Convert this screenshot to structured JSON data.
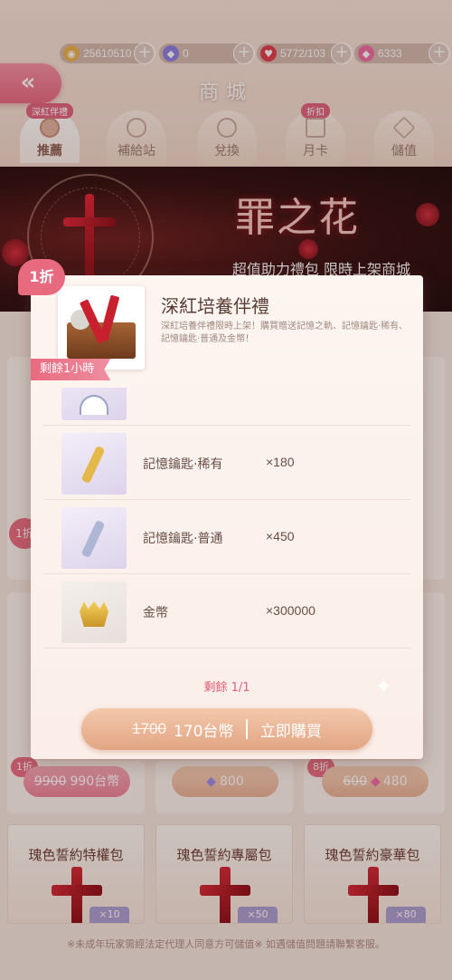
{
  "currencies": [
    {
      "icon": "coin-icon",
      "value": "25610510"
    },
    {
      "icon": "diamond-icon",
      "value": "0"
    },
    {
      "icon": "heart-icon",
      "value": "5772/103"
    },
    {
      "icon": "pink-gem-icon",
      "value": "6333"
    }
  ],
  "header": {
    "title": "商城",
    "back_label": "«"
  },
  "tabs": [
    {
      "label": "推薦",
      "badge": "深紅伴禮",
      "active": true
    },
    {
      "label": "補給站",
      "badge": ""
    },
    {
      "label": "兌換",
      "badge": ""
    },
    {
      "label": "月卡",
      "badge": "折扣"
    },
    {
      "label": "儲值",
      "badge": ""
    }
  ],
  "banner": {
    "title": "罪之花",
    "subtitle": "超值助力禮包 限時上架商城"
  },
  "background": {
    "left_badges": [
      "1折",
      "1折"
    ],
    "row_prices": [
      {
        "old": "9900",
        "new": "990台幣"
      },
      {
        "icon": "diamond-icon",
        "new": "800"
      },
      {
        "old": "600",
        "new": "480",
        "badge": "8折"
      }
    ],
    "badge_left": "1折",
    "packs": [
      {
        "name": "瑰色誓約特權包",
        "tag": "×10"
      },
      {
        "name": "瑰色誓約專屬包",
        "tag": "×50"
      },
      {
        "name": "瑰色誓約豪華包",
        "tag": "×80"
      }
    ],
    "footer": "※未成年玩家需經法定代理人同意方可儲值※ 如遇儲值問題請聯繫客服。"
  },
  "modal": {
    "discount": "1折",
    "title": "深紅培養伴禮",
    "description": "深紅培養伴禮限時上架！購買贈送記憶之軌、記憶鑰匙·稀有、記憶鑰匙·普通及金幣！",
    "timer": "剩餘1小時",
    "items": [
      {
        "name": "",
        "qty": "",
        "icon": "clock-icon"
      },
      {
        "name": "記憶鑰匙·稀有",
        "qty": "×180",
        "icon": "gold-key-icon"
      },
      {
        "name": "記憶鑰匙·普通",
        "qty": "×450",
        "icon": "silver-key-icon"
      },
      {
        "name": "金幣",
        "qty": "×300000",
        "icon": "gold-coin-icon"
      }
    ],
    "remaining": "剩餘 1/1",
    "buy": {
      "old_price": "1700",
      "new_price": "170台幣",
      "action": "立即購買"
    }
  },
  "colors": {
    "accent_pink": "#e86a7f",
    "button_peach": "#e2a583"
  }
}
